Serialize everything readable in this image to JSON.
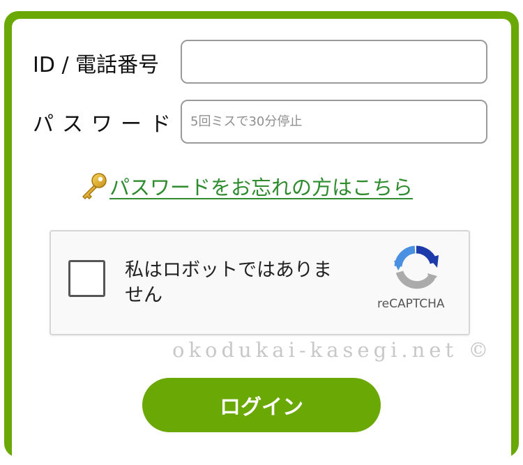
{
  "colors": {
    "accent": "#6aa806",
    "link": "#2e8b2e",
    "watermark": "#c8c8c8"
  },
  "form": {
    "id_label": "ID / 電話番号",
    "id_value": "",
    "password_label": "パスワード",
    "password_value": "",
    "password_placeholder": "5回ミスで30分停止",
    "forgot_link": "パスワードをお忘れの方はこちら",
    "forgot_icon": "key-icon"
  },
  "captcha": {
    "label": "私はロボットではありません",
    "brand": "reCAPTCHA",
    "checked": false,
    "logo_icon": "recaptcha-logo-icon"
  },
  "watermark": "okodukai-kasegi.net ©",
  "login_button": "ログイン"
}
